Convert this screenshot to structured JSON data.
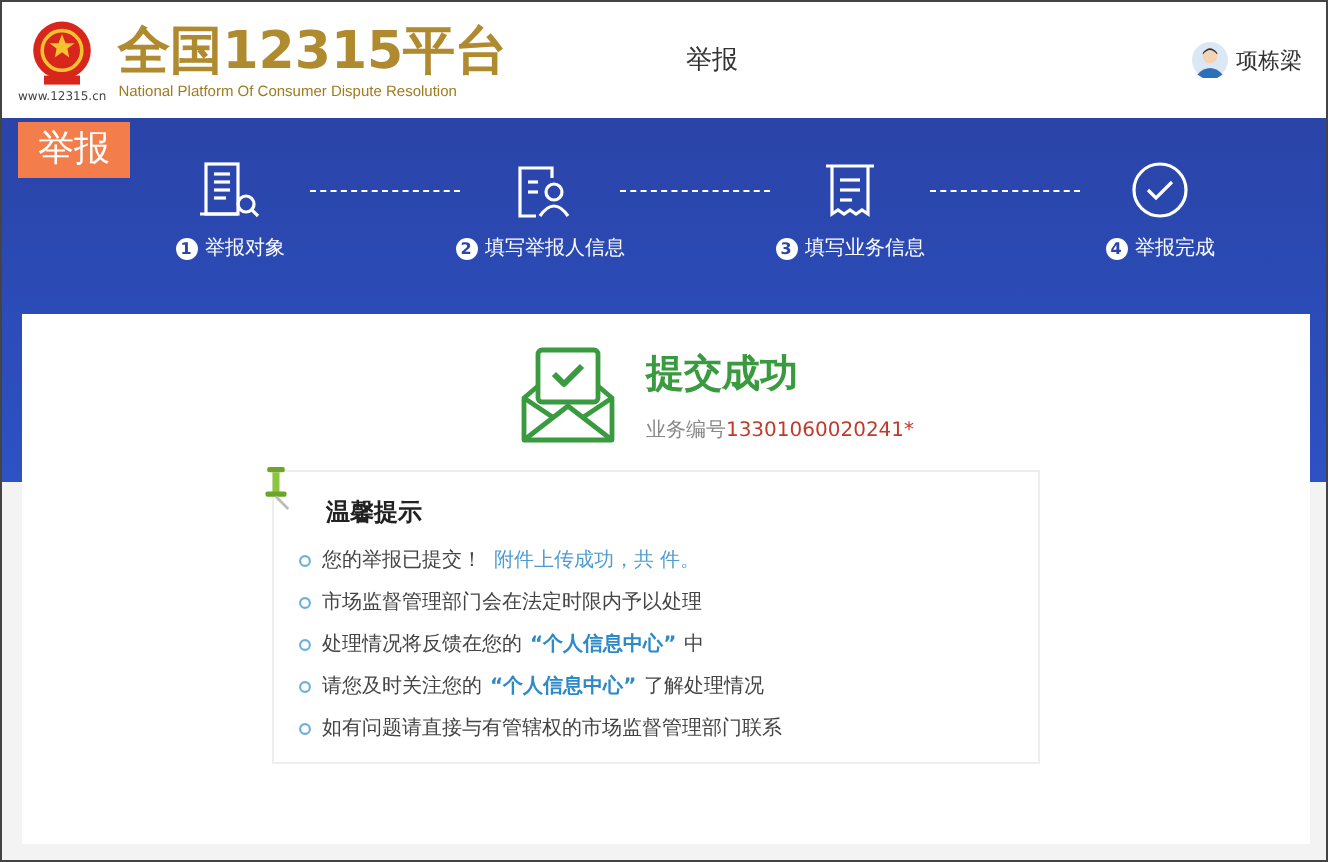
{
  "header": {
    "logo_title": "全国12315平台",
    "logo_subtitle": "National Platform Of Consumer Dispute Resolution",
    "logo_url": "www.12315.cn",
    "nav_item": "举报",
    "user_name": "项栋梁"
  },
  "banner": {
    "tab": "举报",
    "steps": [
      {
        "number": "1",
        "label": "举报对象",
        "kind": "building"
      },
      {
        "number": "2",
        "label": "填写举报人信息",
        "kind": "person"
      },
      {
        "number": "3",
        "label": "填写业务信息",
        "kind": "receipt"
      },
      {
        "number": "4",
        "label": "举报完成",
        "kind": "check"
      }
    ]
  },
  "result": {
    "title": "提交成功",
    "id_label": "业务编号",
    "id_value": "13301060020241*"
  },
  "tips": {
    "title": "温馨提示",
    "items": [
      {
        "parts": [
          {
            "text": "您的举报已提交！",
            "kind": "plain"
          },
          {
            "text": "附件上传成功，共 件。",
            "kind": "note"
          }
        ]
      },
      {
        "parts": [
          {
            "text": "市场监督管理部门会在法定时限内予以处理",
            "kind": "plain"
          }
        ]
      },
      {
        "parts": [
          {
            "text": "处理情况将反馈在您的",
            "kind": "plain"
          },
          {
            "text": "“个人信息中心”",
            "kind": "highlight"
          },
          {
            "text": "中",
            "kind": "plain"
          }
        ]
      },
      {
        "parts": [
          {
            "text": "请您及时关注您的",
            "kind": "plain"
          },
          {
            "text": "“个人信息中心”",
            "kind": "highlight"
          },
          {
            "text": "了解处理情况",
            "kind": "plain"
          }
        ]
      },
      {
        "parts": [
          {
            "text": "如有问题请直接与有管辖权的市场监督管理部门联系",
            "kind": "plain"
          }
        ]
      }
    ]
  }
}
